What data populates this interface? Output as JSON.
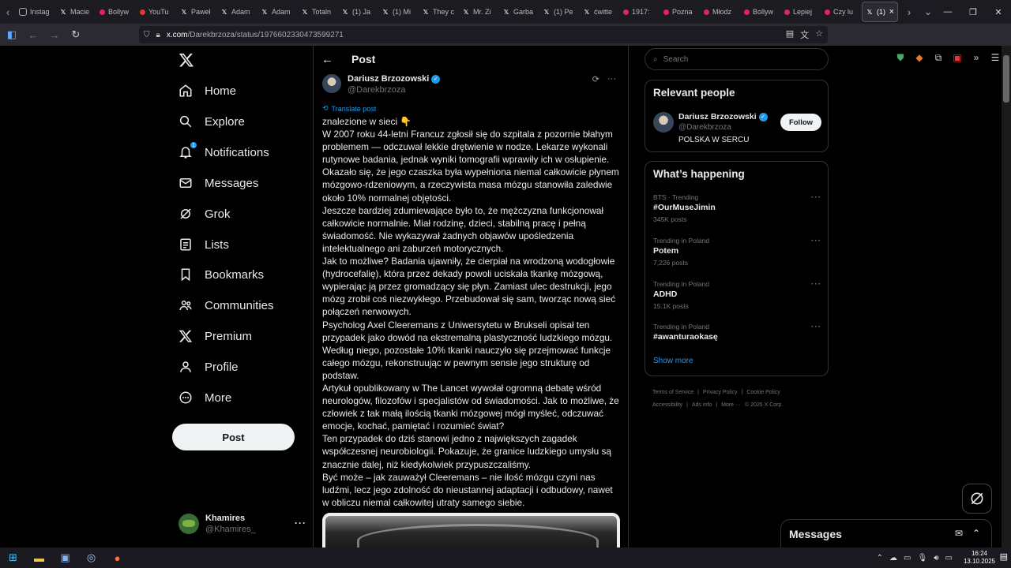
{
  "browser": {
    "tabs": [
      {
        "label": "Instag",
        "icon": "instagram-icon"
      },
      {
        "label": "Macie",
        "icon": "x-icon"
      },
      {
        "label": "Bollyw",
        "icon": "dot-icon"
      },
      {
        "label": "YouTu",
        "icon": "youtube-icon"
      },
      {
        "label": "Paweł",
        "icon": "x-icon"
      },
      {
        "label": "Adam",
        "icon": "x-icon"
      },
      {
        "label": "Adam",
        "icon": "x-icon"
      },
      {
        "label": "Totaln",
        "icon": "x-icon"
      },
      {
        "label": "(1) Ja",
        "icon": "x-icon"
      },
      {
        "label": "(1) Mi",
        "icon": "x-icon"
      },
      {
        "label": "They c",
        "icon": "x-icon"
      },
      {
        "label": "Mr. Zi",
        "icon": "x-icon"
      },
      {
        "label": "Garba",
        "icon": "x-icon"
      },
      {
        "label": "(1) Pe",
        "icon": "x-icon"
      },
      {
        "label": "ćwitte",
        "icon": "x-icon"
      },
      {
        "label": "1917:",
        "icon": "dot-icon"
      },
      {
        "label": "Pozna",
        "icon": "dot-icon"
      },
      {
        "label": "Młodz",
        "icon": "dot-icon"
      },
      {
        "label": "Bollyw",
        "icon": "dot-icon"
      },
      {
        "label": "Lepiej",
        "icon": "dot-icon"
      },
      {
        "label": "Czy lu",
        "icon": "dot-icon"
      }
    ],
    "active_tab": {
      "label": "(1)",
      "close": "×"
    },
    "url_host": "x.com",
    "url_path": "/Darekbrzoza/status/1976602330473599271"
  },
  "nav": {
    "items": [
      {
        "id": "home",
        "label": "Home",
        "icon": "home-icon"
      },
      {
        "id": "explore",
        "label": "Explore",
        "icon": "search-icon"
      },
      {
        "id": "notifications",
        "label": "Notifications",
        "icon": "bell-icon",
        "badge": "1"
      },
      {
        "id": "messages",
        "label": "Messages",
        "icon": "envelope-icon"
      },
      {
        "id": "grok",
        "label": "Grok",
        "icon": "grok-icon"
      },
      {
        "id": "lists",
        "label": "Lists",
        "icon": "list-icon"
      },
      {
        "id": "bookmarks",
        "label": "Bookmarks",
        "icon": "bookmark-icon"
      },
      {
        "id": "communities",
        "label": "Communities",
        "icon": "people-icon"
      },
      {
        "id": "premium",
        "label": "Premium",
        "icon": "x-icon"
      },
      {
        "id": "profile",
        "label": "Profile",
        "icon": "person-icon"
      },
      {
        "id": "more",
        "label": "More",
        "icon": "more-circle-icon"
      }
    ],
    "post_button": "Post",
    "account": {
      "name": "Khamires",
      "handle": "@Khamires_"
    }
  },
  "main": {
    "title": "Post",
    "author": {
      "name": "Dariusz Brzozowski",
      "handle": "@Darekbrzoza"
    },
    "translate_label": "Translate post",
    "paragraphs": [
      "znalezione w sieci 👇",
      "W 2007 roku 44-letni Francuz zgłosił się do szpitala z pozornie błahym problemem — odczuwał lekkie drętwienie w nodze. Lekarze wykonali rutynowe badania, jednak wyniki tomografii wprawiły ich w osłupienie. Okazało się, że jego czaszka była wypełniona niemal całkowicie płynem mózgowo-rdzeniowym, a rzeczywista masa mózgu stanowiła zaledwie około 10% normalnej objętości.",
      "Jeszcze bardziej zdumiewające było to, że mężczyzna funkcjonował całkowicie normalnie. Miał rodzinę, dzieci, stabilną pracę i pełną świadomość. Nie wykazywał żadnych objawów upośledzenia intelektualnego ani zaburzeń motorycznych.",
      "Jak to możliwe? Badania ujawniły, że cierpiał na wrodzoną wodogłowie (hydrocefalię), która przez dekady powoli uciskała tkankę mózgową, wypierając ją przez gromadzący się płyn. Zamiast ulec destrukcji, jego mózg zrobił coś niezwykłego. Przebudował się sam, tworząc nową sieć połączeń nerwowych.",
      "Psycholog Axel Cleeremans z Uniwersytetu w Brukseli opisał ten przypadek jako dowód na ekstremalną plastyczność ludzkiego mózgu. Według niego, pozostałe 10% tkanki nauczyło się przejmować funkcje całego mózgu, rekonstruując w pewnym sensie jego strukturę od podstaw.",
      "Artykuł opublikowany w The Lancet wywołał ogromną debatę wśród neurologów, filozofów i specjalistów od świadomości. Jak to możliwe, że człowiek z tak małą ilością tkanki mózgowej mógł myśleć, odczuwać emocje, kochać, pamiętać i rozumieć świat?",
      "Ten przypadek do dziś stanowi jedno z największych zagadek współczesnej neurobiologii. Pokazuje, że granice ludzkiego umysłu są znacznie dalej, niż kiedykolwiek przypuszczaliśmy.",
      "Być może – jak zauważył Cleeremans – nie ilość mózgu czyni nas ludźmi, lecz jego zdolność do nieustannej adaptacji i odbudowy, nawet w obliczu niemal całkowitej utraty samego siebie."
    ]
  },
  "sidebar": {
    "search_placeholder": "Search",
    "relevant": {
      "title": "Relevant people",
      "name": "Dariusz Brzozowski",
      "handle": "@Darekbrzoza",
      "bio": "POLSKA W SERCU",
      "follow": "Follow"
    },
    "happening": {
      "title": "What’s happening",
      "trends": [
        {
          "context": "BTS · Trending",
          "name": "#OurMuseJimin",
          "count": "345K posts"
        },
        {
          "context": "Trending in Poland",
          "name": "Potem",
          "count": "7,226 posts"
        },
        {
          "context": "Trending in Poland",
          "name": "ADHD",
          "count": "15.1K posts"
        },
        {
          "context": "Trending in Poland",
          "name": "#awanturaokasę",
          "count": ""
        }
      ],
      "show_more": "Show more"
    },
    "footer": {
      "links": [
        "Terms of Service",
        "Privacy Policy",
        "Cookie Policy",
        "Accessibility",
        "Ads info",
        "More ···"
      ],
      "copyright": "© 2025 X Corp."
    }
  },
  "messages_drawer": {
    "title": "Messages"
  },
  "taskbar": {
    "time": "16:24",
    "date": "13.10.2025"
  },
  "colors": {
    "accent": "#1d9bf0",
    "background": "#000000",
    "border": "#2f3336",
    "muted": "#71767b",
    "text": "#e7e9ea"
  }
}
